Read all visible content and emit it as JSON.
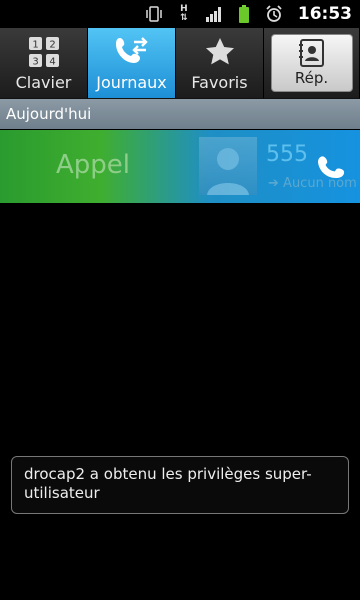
{
  "status_bar": {
    "network_label": "H",
    "time": "16:53"
  },
  "tabs": [
    {
      "label": "Clavier",
      "icon": "keypad-icon",
      "active": false
    },
    {
      "label": "Journaux",
      "icon": "call-log-icon",
      "active": true
    },
    {
      "label": "Favoris",
      "icon": "star-icon",
      "active": false
    },
    {
      "label": "Rép.",
      "icon": "contacts-icon",
      "active": false
    }
  ],
  "section": {
    "title": "Aujourd'hui"
  },
  "call_entry": {
    "action_label": "Appel",
    "number": "555",
    "sub_label": "Aucun nom",
    "icon": "phone-icon"
  },
  "toast": {
    "message": "drocap2 a obtenu les privilèges super-utilisateur"
  },
  "colors": {
    "accent": "#1d8fd6",
    "call_green": "#3fae2f",
    "header_gray": "#7b8b96"
  }
}
